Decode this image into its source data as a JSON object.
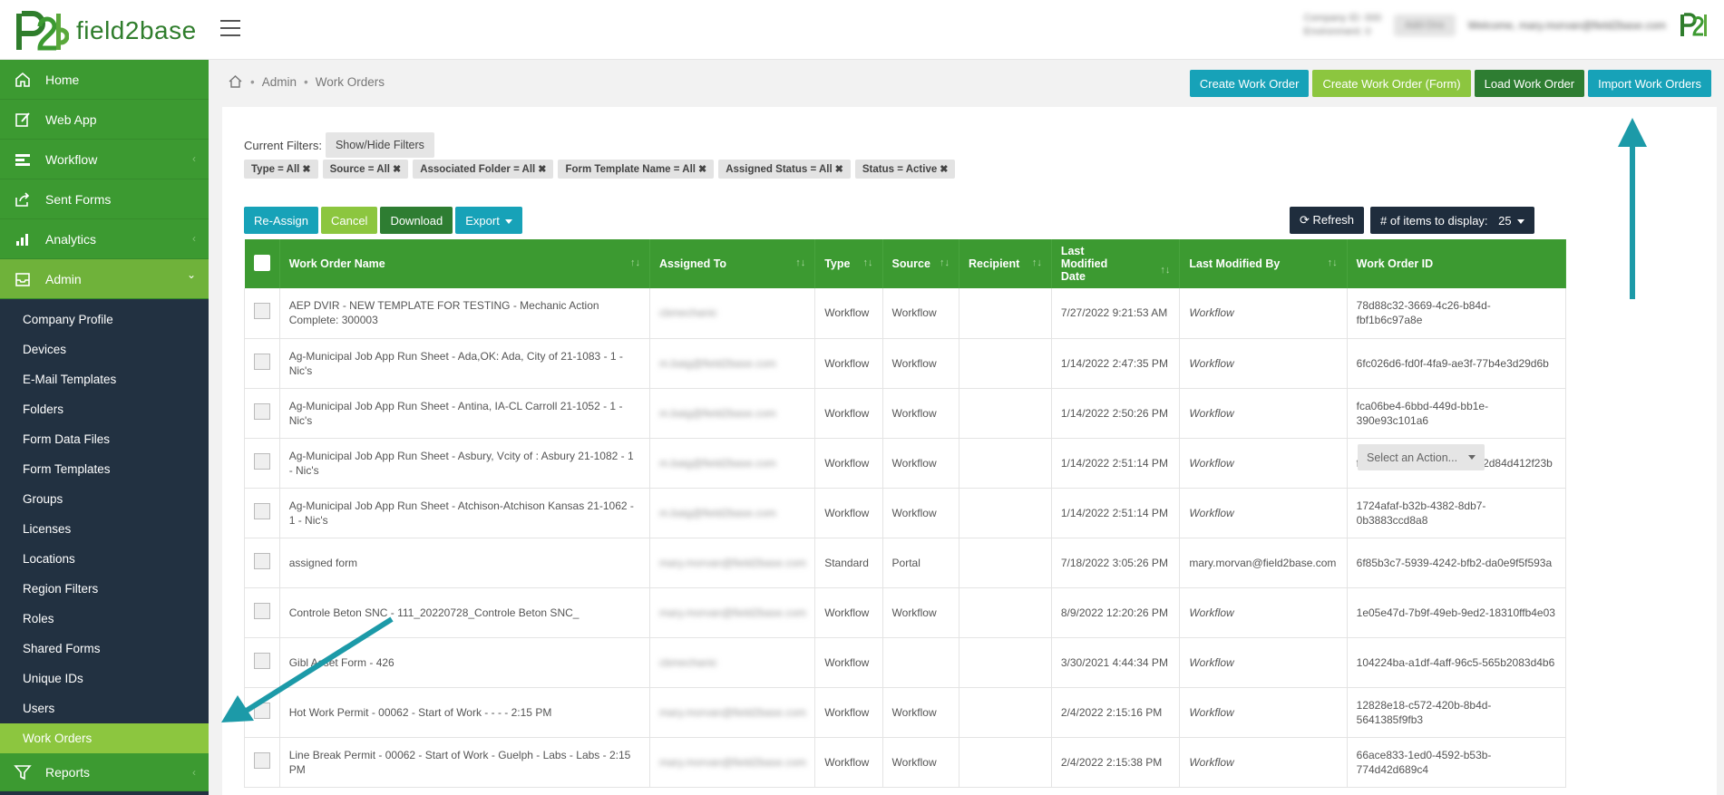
{
  "brand": {
    "name": "field2base"
  },
  "topbar": {
    "company_line1": "Company ID: 000",
    "company_line2": "Environment: 0",
    "badge": "Add-Ons",
    "welcome": "Welcome, mary.morvan@field2base.com"
  },
  "sidebar": {
    "items": [
      {
        "label": "Home",
        "icon": "home-icon"
      },
      {
        "label": "Web App",
        "icon": "edit-icon"
      },
      {
        "label": "Workflow",
        "icon": "workflow-icon",
        "chevron": "‹"
      },
      {
        "label": "Sent Forms",
        "icon": "share-icon"
      },
      {
        "label": "Analytics",
        "icon": "bar-chart-icon",
        "chevron": "‹"
      },
      {
        "label": "Admin",
        "icon": "inbox-icon",
        "chevron": "⌄"
      }
    ],
    "admin_sub": [
      "Company Profile",
      "Devices",
      "E-Mail Templates",
      "Folders",
      "Form Data Files",
      "Form Templates",
      "Groups",
      "Licenses",
      "Locations",
      "Region Filters",
      "Roles",
      "Shared Forms",
      "Unique IDs",
      "Users",
      "Work Orders"
    ],
    "reports": {
      "label": "Reports",
      "icon": "filter-icon",
      "chevron": "‹"
    }
  },
  "breadcrumb": {
    "sep1": "•",
    "admin": "Admin",
    "sep2": "•",
    "current": "Work Orders"
  },
  "top_actions": {
    "create": "Create Work Order",
    "create_form": "Create Work Order (Form)",
    "load": "Load Work Order",
    "import": "Import Work Orders"
  },
  "filters": {
    "label": "Current Filters:",
    "toggle": "Show/Hide Filters",
    "chips": [
      "Type = All",
      "Source = All",
      "Associated Folder = All",
      "Form Template Name = All",
      "Assigned Status = All",
      "Status = Active"
    ]
  },
  "toolbar": {
    "reassign": "Re-Assign",
    "cancel": "Cancel",
    "download": "Download",
    "export": "Export",
    "refresh": "Refresh",
    "items_label": "# of items to display:",
    "items_value": "25"
  },
  "table": {
    "columns": [
      "Work Order Name",
      "Assigned To",
      "Type",
      "Source",
      "Recipient",
      "Last Modified Date",
      "Last Modified By",
      "Work Order ID"
    ],
    "rows": [
      {
        "name": "AEP DVIR - NEW TEMPLATE FOR TESTING - Mechanic Action Complete: 300003",
        "assigned": "cbmechanic",
        "type": "Workflow",
        "source": "Workflow",
        "recipient": "",
        "date": "7/27/2022 9:21:53 AM",
        "by": "Workflow",
        "id": "78d88c32-3669-4c26-b84d-fbf1b6c97a8e"
      },
      {
        "name": "Ag-Municipal Job App Run Sheet - Ada,OK: Ada, City of 21-1083 - 1 - Nic's",
        "assigned": "m.baig@field2base.com",
        "type": "Workflow",
        "source": "Workflow",
        "recipient": "",
        "date": "1/14/2022 2:47:35 PM",
        "by": "Workflow",
        "id": "6fc026d6-fd0f-4fa9-ae3f-77b4e3d29d6b"
      },
      {
        "name": "Ag-Municipal Job App Run Sheet - Antina, IA-CL Carroll 21-1052 - 1 - Nic's",
        "assigned": "m.baig@field2base.com",
        "type": "Workflow",
        "source": "Workflow",
        "recipient": "",
        "date": "1/14/2022 2:50:26 PM",
        "by": "Workflow",
        "id": "fca06be4-6bbd-449d-bb1e-390e93c101a6"
      },
      {
        "name": "Ag-Municipal Job App Run Sheet - Asbury, Vcity of : Asbury 21-1082 - 1 - Nic's",
        "assigned": "m.baig@field2base.com",
        "type": "Workflow",
        "source": "Workflow",
        "recipient": "",
        "date": "1/14/2022 2:51:14 PM",
        "by": "Workflow",
        "id": "f104fb75-413e-480f-9109-2d84d412f23b"
      },
      {
        "name": "Ag-Municipal Job App Run Sheet - Atchison-Atchison Kansas 21-1062 - 1 - Nic's",
        "assigned": "m.baig@field2base.com",
        "type": "Workflow",
        "source": "Workflow",
        "recipient": "",
        "date": "1/14/2022 2:51:14 PM",
        "by": "Workflow",
        "id": "1724afaf-b32b-4382-8db7-0b3883ccd8a8"
      },
      {
        "name": "assigned form",
        "assigned": "mary.morvan@field2base.com",
        "type": "Standard",
        "source": "Portal",
        "recipient": "",
        "date": "7/18/2022 3:05:26 PM",
        "by": "mary.morvan@field2base.com",
        "id": "6f85b3c7-5939-4242-bfb2-da0e9f5f593a"
      },
      {
        "name": "Controle Beton SNC - 111_20220728_Controle Beton SNC_",
        "assigned": "mary.morvan@field2base.com",
        "type": "Workflow",
        "source": "Workflow",
        "recipient": "",
        "date": "8/9/2022 12:20:26 PM",
        "by": "Workflow",
        "id": "1e05e47d-7b9f-49eb-9ed2-18310ffb4e03"
      },
      {
        "name": "Gibl Asset Form - 426",
        "assigned": "cbmechanic",
        "type": "Workflow",
        "source": "",
        "recipient": "",
        "date": "3/30/2021 4:44:34 PM",
        "by": "Workflow",
        "id": "104224ba-a1df-4aff-96c5-565b2083d4b6"
      },
      {
        "name": "Hot Work Permit - 00062 - Start of Work - - - - 2:15 PM",
        "assigned": "mary.morvan@field2base.com",
        "type": "Workflow",
        "source": "Workflow",
        "recipient": "",
        "date": "2/4/2022 2:15:16 PM",
        "by": "Workflow",
        "id": "12828e18-c572-420b-8b4d-5641385f9fb3"
      },
      {
        "name": "Line Break Permit - 00062 - Start of Work - Guelph - Labs - Labs - 2:15 PM",
        "assigned": "mary.morvan@field2base.com",
        "type": "Workflow",
        "source": "Workflow",
        "recipient": "",
        "date": "2/4/2022 2:15:38 PM",
        "by": "Workflow",
        "id": "66ace833-1ed0-4592-b53b-774d42d689c4"
      }
    ]
  },
  "row_action": {
    "label": "Select an Action..."
  },
  "colors": {
    "green": "#3c9a31",
    "lime": "#8cc63f",
    "teal": "#17a2b8",
    "dark_green": "#2e7d32",
    "navy": "#1f2d3d",
    "sidebar": "#223141"
  }
}
